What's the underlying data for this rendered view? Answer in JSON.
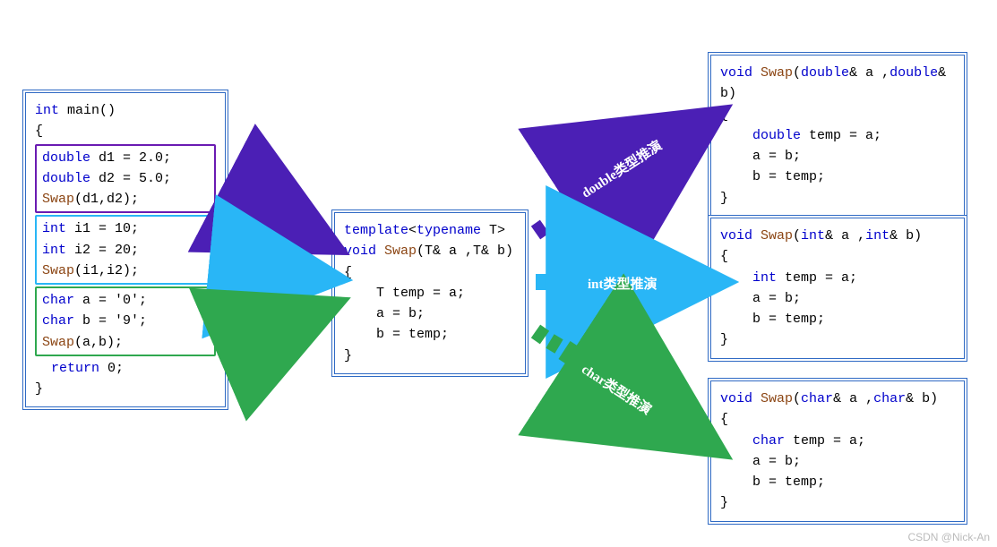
{
  "watermark": "CSDN @Nick-An",
  "labels": {
    "double": "double类型推演",
    "int": "int类型推演",
    "char": "char类型推演"
  },
  "main": {
    "sig_kw": "int",
    "sig_name": "main()",
    "brace_open": "{",
    "brace_close": "}",
    "block1": {
      "l1_kw": "double",
      "l1_rest": " d1 = 2.0;",
      "l2_kw": "double",
      "l2_rest": " d2 = 5.0;",
      "l3_fn": "Swap",
      "l3_rest": "(d1,d2);"
    },
    "block2": {
      "l1_kw": "int",
      "l1_rest": " i1 = 10;",
      "l2_kw": "int",
      "l2_rest": " i2 = 20;",
      "l3_fn": "Swap",
      "l3_rest": "(i1,i2);"
    },
    "block3": {
      "l1_kw": "char",
      "l1_rest": " a = '0';",
      "l2_kw": "char",
      "l2_rest": " b = '9';",
      "l3_fn": "Swap",
      "l3_rest": "(a,b);"
    },
    "ret_kw": "return",
    "ret_rest": " 0;"
  },
  "template": {
    "l1a": "template",
    "l1b": "<",
    "l1c": "typename",
    "l1d": " T>",
    "l2a": "void ",
    "l2b": "Swap",
    "l2c": "(T& a ,T& b)",
    "brace_open": "{",
    "l4": "    T temp = a;",
    "l5": "    a = b;",
    "l6": "    b = temp;",
    "brace_close": "}"
  },
  "inst_double": {
    "l1a": "void ",
    "l1b": "Swap",
    "l1c_kw": "double",
    "l1d": "& a ,",
    "l1e_kw": "double",
    "l1f": "& b)",
    "brace_open": "{",
    "l3_kw": "    double",
    "l3_rest": " temp = a;",
    "l4": "    a = b;",
    "l5": "    b = temp;",
    "brace_close": "}"
  },
  "inst_int": {
    "l1a": "void ",
    "l1b": "Swap",
    "l1c_kw": "int",
    "l1d": "& a ,",
    "l1e_kw": "int",
    "l1f": "& b)",
    "brace_open": "{",
    "l3_kw": "    int",
    "l3_rest": " temp = a;",
    "l4": "    a = b;",
    "l5": "    b = temp;",
    "brace_close": "}"
  },
  "inst_char": {
    "l1a": "void ",
    "l1b": "Swap",
    "l1c_kw": "char",
    "l1d": "& a ,",
    "l1e_kw": "char",
    "l1f": "& b)",
    "brace_open": "{",
    "l3_kw": "    char",
    "l3_rest": " temp = a;",
    "l4": "    a = b;",
    "l5": "    b = temp;",
    "brace_close": "}"
  }
}
